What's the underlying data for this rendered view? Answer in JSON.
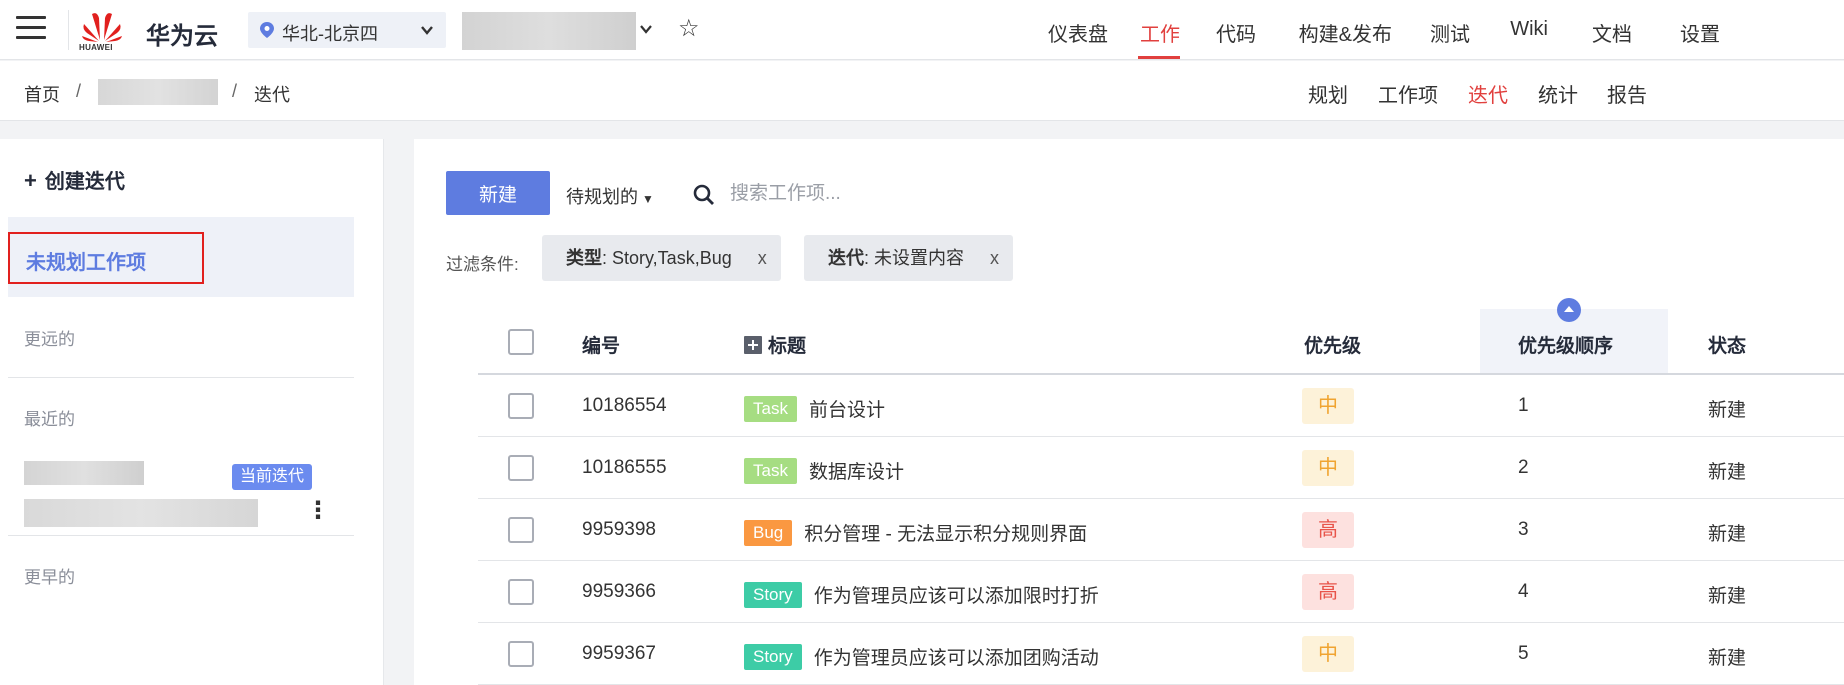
{
  "topbar": {
    "brand": "华为云",
    "logo_text": "HUAWEI",
    "region": "华北-北京四",
    "nav": [
      {
        "label": "仪表盘",
        "active": false
      },
      {
        "label": "工作",
        "active": true
      },
      {
        "label": "代码",
        "active": false
      },
      {
        "label": "构建&发布",
        "active": false
      },
      {
        "label": "测试",
        "active": false
      },
      {
        "label": "Wiki",
        "active": false
      },
      {
        "label": "文档",
        "active": false
      },
      {
        "label": "设置",
        "active": false
      }
    ]
  },
  "breadcrumb": {
    "home": "首页",
    "sep": "/",
    "current": "迭代"
  },
  "subnav": [
    {
      "label": "规划",
      "active": false
    },
    {
      "label": "工作项",
      "active": false
    },
    {
      "label": "迭代",
      "active": true
    },
    {
      "label": "统计",
      "active": false
    },
    {
      "label": "报告",
      "active": false
    }
  ],
  "sidebar": {
    "create_label": "创建迭代",
    "unplanned_label": "未规划工作项",
    "sections": {
      "future": "更远的",
      "recent": "最近的",
      "earlier": "更早的"
    },
    "current_badge": "当前迭代"
  },
  "toolbar": {
    "new_label": "新建",
    "filter_label": "待规划的",
    "search_placeholder": "搜索工作项..."
  },
  "filters": {
    "label": "过滤条件:",
    "chips": [
      {
        "key": "类型",
        "value": ": Story,Task,Bug",
        "close": "x"
      },
      {
        "key": "迭代",
        "value": ": 未设置内容",
        "close": "x"
      }
    ]
  },
  "table": {
    "headers": {
      "id": "编号",
      "title": "标题",
      "priority": "优先级",
      "order": "优先级顺序",
      "status": "状态"
    },
    "rows": [
      {
        "id": "10186554",
        "type": "Task",
        "title": "前台设计",
        "priority": "中",
        "order": "1",
        "status": "新建"
      },
      {
        "id": "10186555",
        "type": "Task",
        "title": "数据库设计",
        "priority": "中",
        "order": "2",
        "status": "新建"
      },
      {
        "id": "9959398",
        "type": "Bug",
        "title": "积分管理 - 无法显示积分规则界面",
        "priority": "高",
        "order": "3",
        "status": "新建"
      },
      {
        "id": "9959366",
        "type": "Story",
        "title": "作为管理员应该可以添加限时打折",
        "priority": "高",
        "order": "4",
        "status": "新建"
      },
      {
        "id": "9959367",
        "type": "Story",
        "title": "作为管理员应该可以添加团购活动",
        "priority": "中",
        "order": "5",
        "status": "新建"
      }
    ]
  },
  "colors": {
    "accent": "#e1403e",
    "primary": "#5e7ce0",
    "tag_task": "#a6dd82",
    "tag_bug": "#fa9841",
    "tag_story": "#3dcca6",
    "prio_mid_bg": "#fdf2d9",
    "prio_mid_fg": "#f0a431",
    "prio_high_bg": "#fde1df",
    "prio_high_fg": "#e8544a"
  }
}
